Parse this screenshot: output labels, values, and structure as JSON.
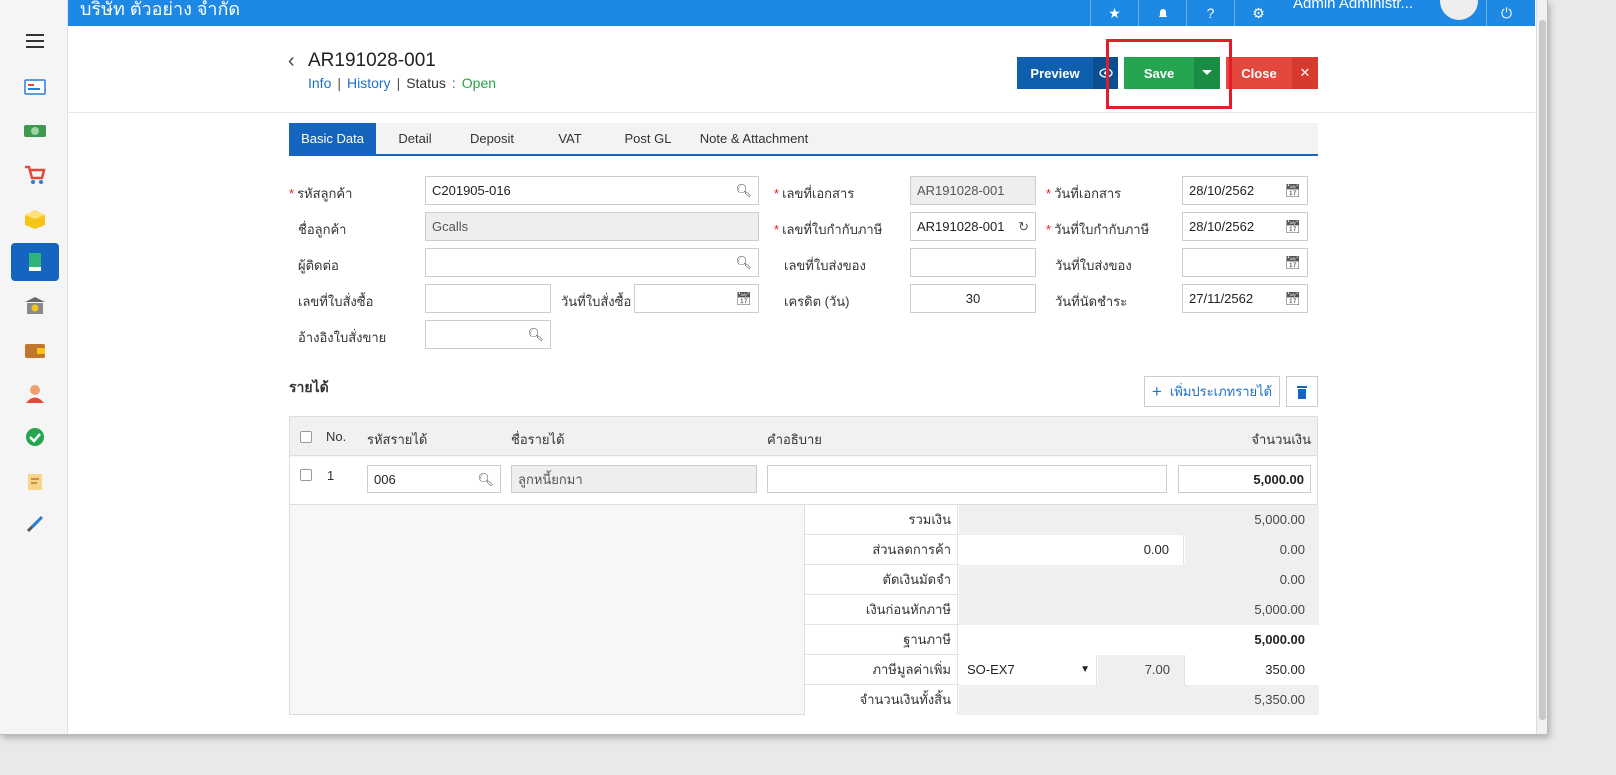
{
  "header": {
    "company": "บริษัท ตัวอย่าง จำกัด",
    "admin": "Admin Administr..."
  },
  "doc": {
    "title": "AR191028-001",
    "link_info": "Info",
    "link_history": "History",
    "status_label": "Status",
    "status_value": "Open"
  },
  "buttons": {
    "preview": "Preview",
    "save": "Save",
    "close": "Close"
  },
  "tabs": [
    "Basic Data",
    "Detail",
    "Deposit",
    "VAT",
    "Post GL",
    "Note & Attachment"
  ],
  "form": {
    "customer_code_label": "รหัสลูกค้า",
    "customer_code": "C201905-016",
    "customer_name_label": "ชื่อลูกค้า",
    "customer_name": "Gcalls",
    "contact_label": "ผู้ติดต่อ",
    "contact": "",
    "po_no_label": "เลขที่ใบสั่งซื้อ",
    "po_no": "",
    "po_date_label": "วันที่ใบสั่งซื้อ",
    "po_date": "",
    "so_ref_label": "อ้างอิงใบสั่งขาย",
    "so_ref": "",
    "doc_no_label": "เลขที่เอกสาร",
    "doc_no": "AR191028-001",
    "tax_inv_no_label": "เลขที่ใบกำกับภาษี",
    "tax_inv_no": "AR191028-001",
    "delivery_no_label": "เลขที่ใบส่งของ",
    "delivery_no": "",
    "credit_label": "เครดิต (วัน)",
    "credit": "30",
    "doc_date_label": "วันที่เอกสาร",
    "doc_date": "28/10/2562",
    "tax_inv_date_label": "วันที่ใบกำกับภาษี",
    "tax_inv_date": "28/10/2562",
    "delivery_date_label": "วันที่ใบส่งของ",
    "delivery_date": "",
    "due_date_label": "วันที่นัดชำระ",
    "due_date": "27/11/2562"
  },
  "income": {
    "title": "รายได้",
    "add_button": "เพิ่มประเภทรายได้",
    "columns": {
      "no": "No.",
      "code": "รหัสรายได้",
      "name": "ชื่อรายได้",
      "desc": "คำอธิบาย",
      "amount": "จำนวนเงิน"
    },
    "rows": [
      {
        "no": "1",
        "code": "006",
        "name": "ลูกหนี้ยกมา",
        "desc": "",
        "amount": "5,000.00"
      }
    ]
  },
  "summary": {
    "total_label": "รวมเงิน",
    "total": "5,000.00",
    "discount_label": "ส่วนลดการค้า",
    "discount_input": "0.00",
    "discount": "0.00",
    "deposit_label": "ตัดเงินมัดจำ",
    "deposit": "0.00",
    "before_tax_label": "เงินก่อนหักภาษี",
    "before_tax": "5,000.00",
    "tax_base_label": "ฐานภาษี",
    "tax_base": "5,000.00",
    "vat_label": "ภาษีมูลค่าเพิ่ม",
    "vat_code": "SO-EX7",
    "vat_rate": "7.00",
    "vat_amount": "350.00",
    "grand_total_label": "จำนวนเงินทั้งสิ้น",
    "grand_total": "5,350.00"
  },
  "colors": {
    "primary": "#1565c0",
    "topbar": "#1e88e5",
    "save": "#25a550",
    "close": "#e4483c",
    "open_status": "#2aa14b",
    "highlight": "#e21d2a"
  },
  "sidebar_icons": [
    "menu-icon",
    "dashboard-icon",
    "money-icon",
    "cart-icon",
    "box-icon",
    "book-icon",
    "bank-icon",
    "wallet-icon",
    "user-icon",
    "check-icon",
    "transfer-icon",
    "tools-icon"
  ]
}
